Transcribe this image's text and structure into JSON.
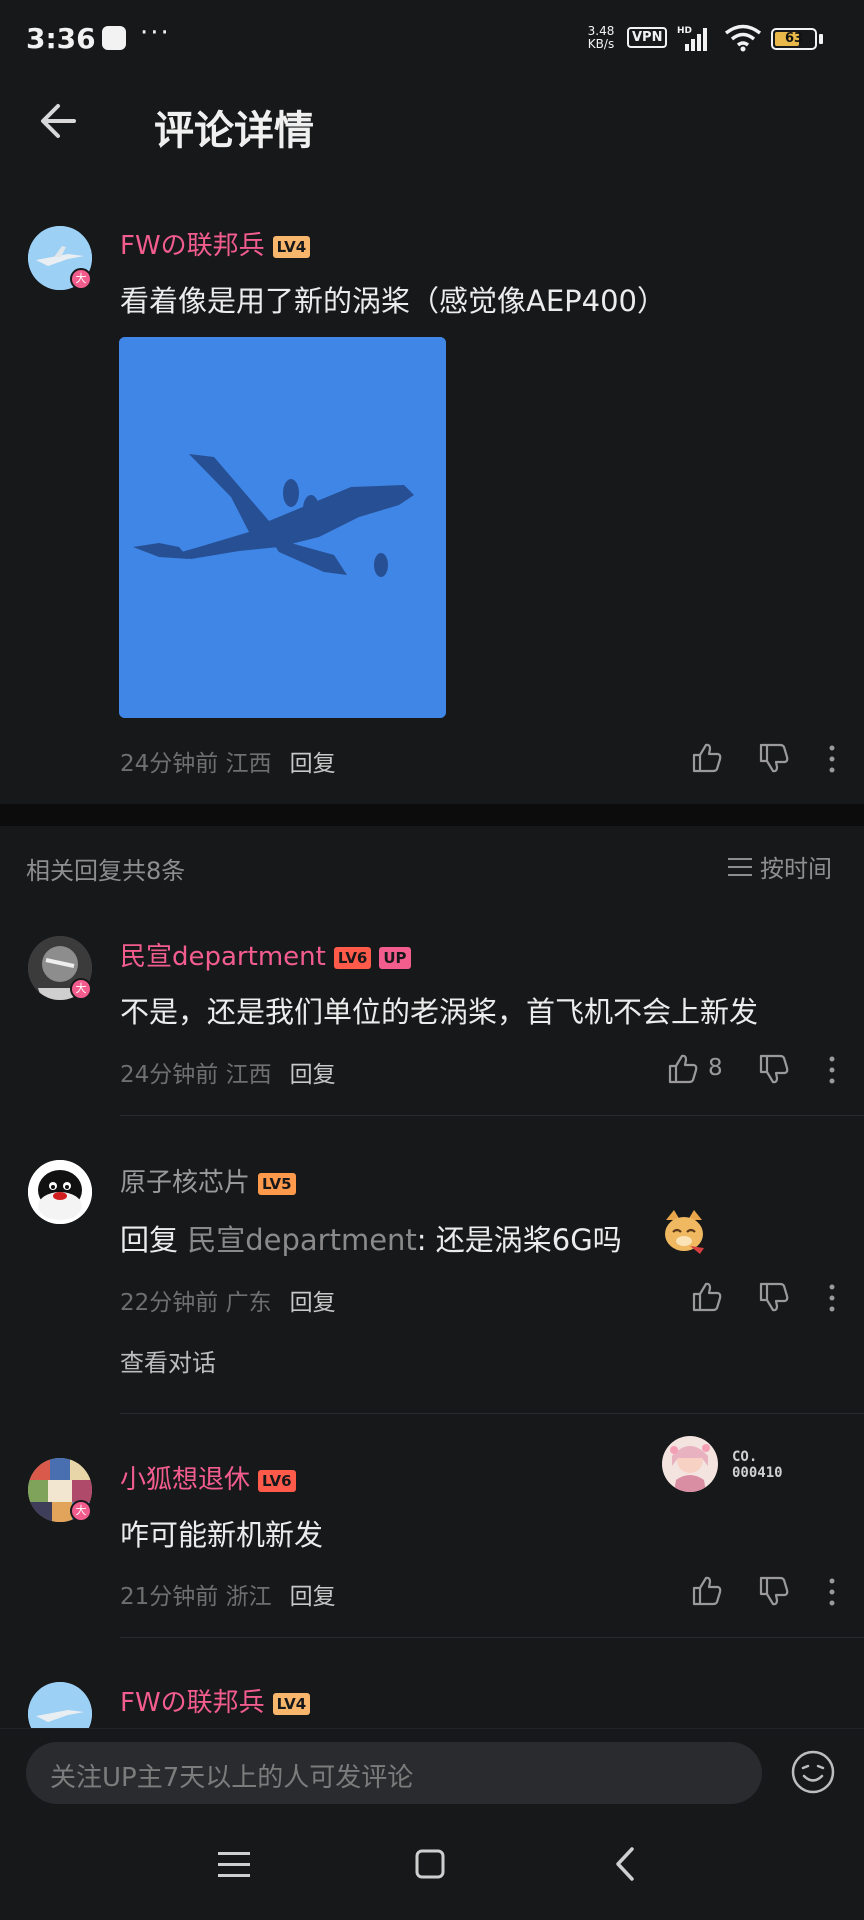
{
  "status_bar": {
    "time": "3:36",
    "dots": "···",
    "net_speed_value": "3.48",
    "net_speed_unit": "KB/s",
    "vpn": "VPN",
    "battery": "63",
    "battery_level": 0.63
  },
  "header": {
    "title": "评论详情"
  },
  "main_comment": {
    "user": "FWの联邦兵",
    "level": "LV4",
    "avatar_badge": "大",
    "text": "看着像是用了新的涡桨（感觉像AEP400）",
    "time": "24分钟前",
    "location": "江西",
    "reply_label": "回复"
  },
  "replies_section": {
    "count_label": "相关回复共8条",
    "sort_label": "按时间"
  },
  "replies": [
    {
      "user": "民宣department",
      "level": "LV6",
      "up_tag": "UP",
      "avatar_badge": "大",
      "text": "不是，还是我们单位的老涡桨，首飞机不会上新发",
      "time": "24分钟前",
      "location": "江西",
      "reply_label": "回复",
      "likes": "8"
    },
    {
      "user": "原子核芯片",
      "level": "LV5",
      "reply_prefix": "回复 ",
      "reply_target": "民宣department",
      "text": ": 还是涡桨6G吗",
      "time": "22分钟前",
      "location": "广东",
      "reply_label": "回复",
      "view_conversation": "查看对话"
    },
    {
      "user": "小狐想退休",
      "level": "LV6",
      "avatar_badge": "大",
      "fan_badge_line1": "CO.",
      "fan_badge_line2": "000410",
      "text": "咋可能新机新发",
      "time": "21分钟前",
      "location": "浙江",
      "reply_label": "回复"
    },
    {
      "user": "FWの联邦兵",
      "level": "LV4"
    }
  ],
  "input": {
    "placeholder": "关注UP主7天以上的人可发评论"
  },
  "colors": {
    "accent_pink": "#f25d8e",
    "background": "#17181a",
    "image_sky": "#3f85e4"
  }
}
